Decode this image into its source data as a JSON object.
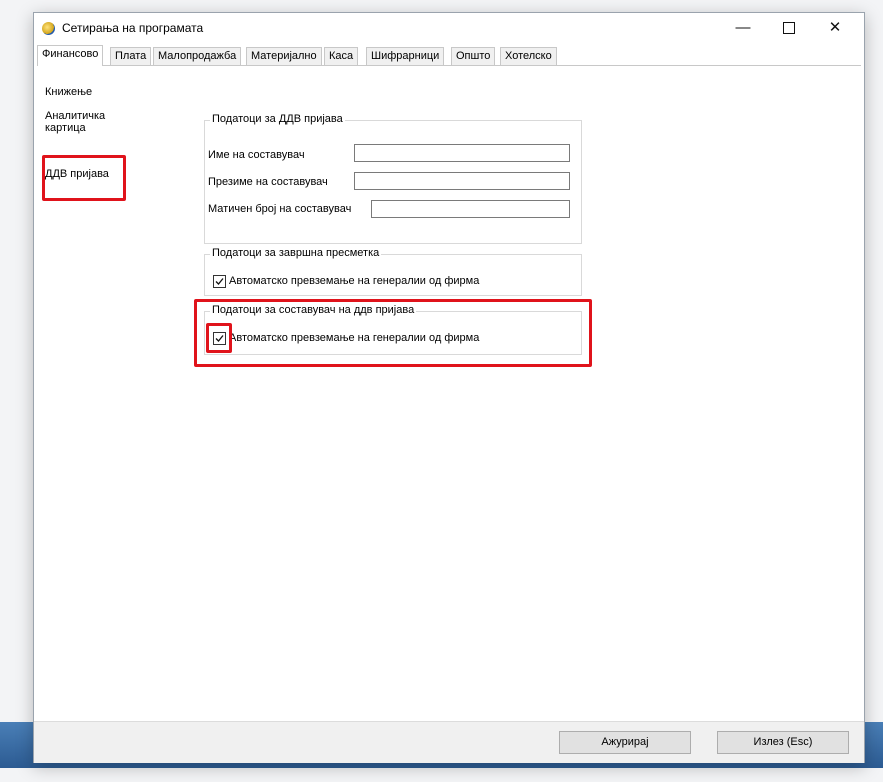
{
  "window": {
    "title": "Сетирања на програмата"
  },
  "tabs": [
    "Финансово",
    "Плата",
    "Малопродажба",
    "Материјално",
    "Каса",
    "Шифрарници",
    "Општо",
    "Хотелско"
  ],
  "sidebar": {
    "items": [
      "Книжење",
      "Аналитичка картица",
      "ДДВ пријава"
    ],
    "selected": "ДДВ пријава"
  },
  "groups": {
    "vat_data": {
      "legend": "Податоци за ДДВ пријава",
      "fields": [
        {
          "label": "Име на составувач",
          "value": ""
        },
        {
          "label": "Презиме на составувач",
          "value": ""
        },
        {
          "label": "Матичен број на составувач",
          "value": ""
        }
      ]
    },
    "final_calc": {
      "legend": "Податоци за завршна пресметка",
      "checkbox": {
        "label": "Автоматско превземање на генералии од фирма",
        "checked": true
      }
    },
    "vat_author": {
      "legend": "Податоци за составувач на ддв пријава",
      "checkbox": {
        "label": "Автоматско превземање на генералии од фирма",
        "checked": true
      }
    }
  },
  "buttons": {
    "update": "Ажурирај",
    "exit": "Излез (Esc)"
  },
  "colors": {
    "highlight": "#e0131b",
    "taskbar": "#2c5b92"
  }
}
